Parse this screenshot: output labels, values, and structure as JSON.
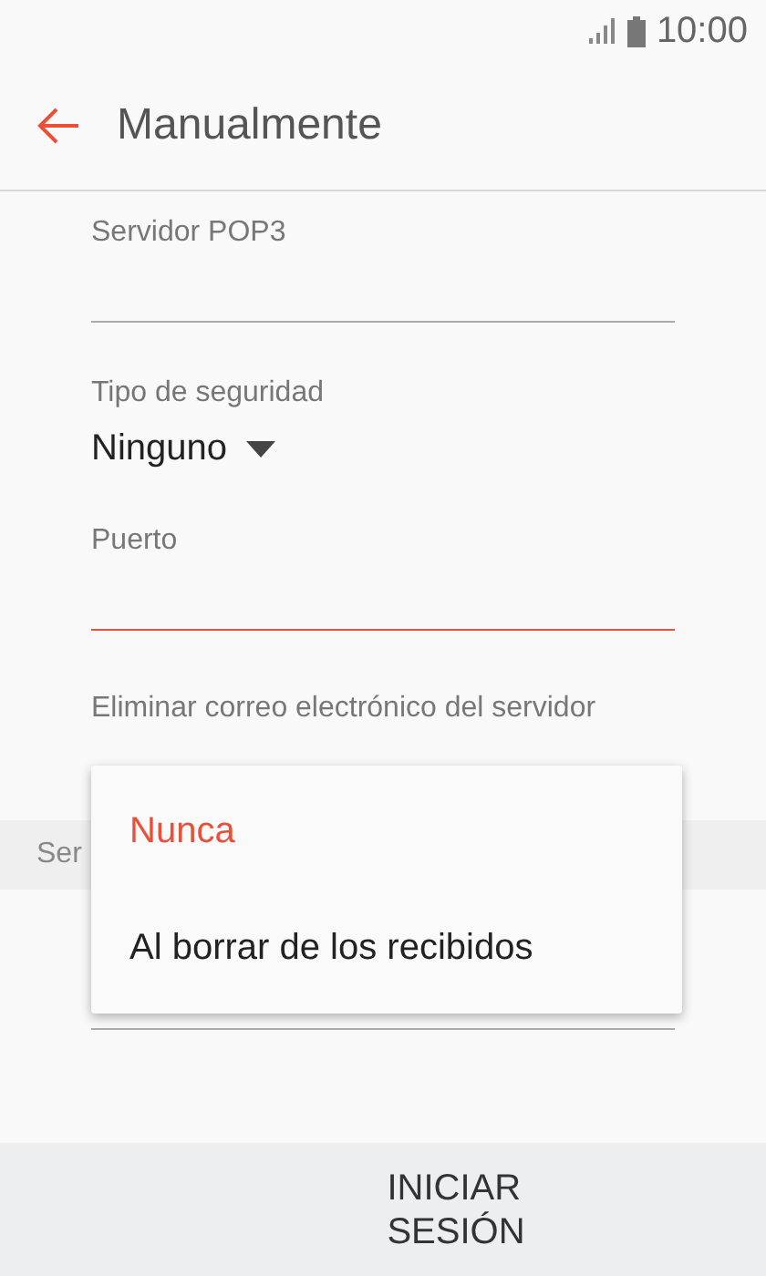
{
  "status_bar": {
    "time": "10:00"
  },
  "header": {
    "title": "Manualmente"
  },
  "fields": [
    {
      "kind": "text",
      "label": "Servidor POP3",
      "focused": false
    },
    {
      "kind": "select",
      "label": "Tipo de seguridad",
      "value": "Ninguno"
    },
    {
      "kind": "text",
      "label": "Puerto",
      "focused": true
    },
    {
      "kind": "label",
      "label": "Eliminar correo electrónico del servidor"
    }
  ],
  "section": {
    "title": "Ser"
  },
  "section_fields": [
    {
      "kind": "text",
      "focused": false
    }
  ],
  "menu": {
    "items": [
      {
        "label": "Nunca",
        "selected": true
      },
      {
        "label": "Al borrar de los recibidos",
        "selected": false
      }
    ]
  },
  "footer": {
    "button": "INICIAR\nSESIÓN"
  }
}
